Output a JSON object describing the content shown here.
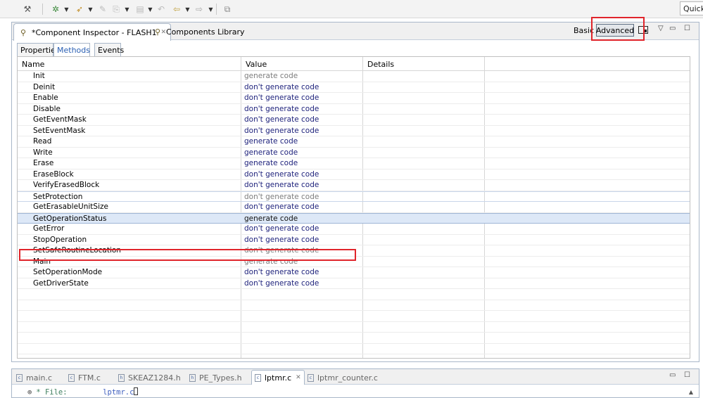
{
  "toolbar": {
    "buttons": [
      "wrench-icon",
      "debug-icon",
      "run-icon",
      "build-icon",
      "copy-icon",
      "paste-icon",
      "undo-icon",
      "back-icon",
      "forward-icon",
      "external-icon"
    ],
    "quick_access": "Quick Access"
  },
  "view": {
    "tabs": [
      {
        "label": "*Component Inspector - FLASH1",
        "active": true
      },
      {
        "label": "Components Library",
        "active": false
      }
    ],
    "mode_basic": "Basic",
    "mode_advanced": "Advanced",
    "inner_tabs": [
      "Properties",
      "Methods",
      "Events"
    ],
    "active_inner_tab": "Methods"
  },
  "table": {
    "columns": [
      "Name",
      "Value",
      "Details"
    ],
    "rows": [
      {
        "name": "Init",
        "value": "generate code",
        "style": "gray"
      },
      {
        "name": "Deinit",
        "value": "don't generate code",
        "style": "dark"
      },
      {
        "name": "Enable",
        "value": "don't generate code",
        "style": "dark"
      },
      {
        "name": "Disable",
        "value": "don't generate code",
        "style": "dark"
      },
      {
        "name": "GetEventMask",
        "value": "don't generate code",
        "style": "dark"
      },
      {
        "name": "SetEventMask",
        "value": "don't generate code",
        "style": "dark"
      },
      {
        "name": "Read",
        "value": "generate code",
        "style": "dark"
      },
      {
        "name": "Write",
        "value": "generate code",
        "style": "dark"
      },
      {
        "name": "Erase",
        "value": "generate code",
        "style": "dark"
      },
      {
        "name": "EraseBlock",
        "value": "don't generate code",
        "style": "dark"
      },
      {
        "name": "VerifyErasedBlock",
        "value": "don't generate code",
        "style": "dark"
      },
      {
        "name": "SetProtection",
        "value": "don't generate code",
        "style": "gray"
      },
      {
        "name": "GetErasableUnitSize",
        "value": "don't generate code",
        "style": "dark"
      },
      {
        "name": "GetOperationStatus",
        "value": "generate code",
        "style": "black"
      },
      {
        "name": "GetError",
        "value": "don't generate code",
        "style": "dark"
      },
      {
        "name": "StopOperation",
        "value": "don't generate code",
        "style": "dark"
      },
      {
        "name": "SetSafeRoutineLocation",
        "value": "don't generate code",
        "style": "gray"
      },
      {
        "name": "Main",
        "value": "generate code",
        "style": "gray"
      },
      {
        "name": "SetOperationMode",
        "value": "don't generate code",
        "style": "dark"
      },
      {
        "name": "GetDriverState",
        "value": "don't generate code",
        "style": "dark"
      }
    ],
    "selected_row": "GetOperationStatus"
  },
  "editor": {
    "tabs": [
      "main.c",
      "FTM.c",
      "SKEAZ1284.h",
      "PE_Types.h",
      "lptmr.c",
      "lptmr_counter.c"
    ],
    "active_tab": "lptmr.c",
    "code_prefix": "* File:",
    "code_file": "lptmr.c"
  },
  "colors": {
    "value_dark": "#1b1f7a",
    "value_gray": "#7d7d7d",
    "highlight_box": "#e0252b",
    "selection": "#dde8f7"
  }
}
